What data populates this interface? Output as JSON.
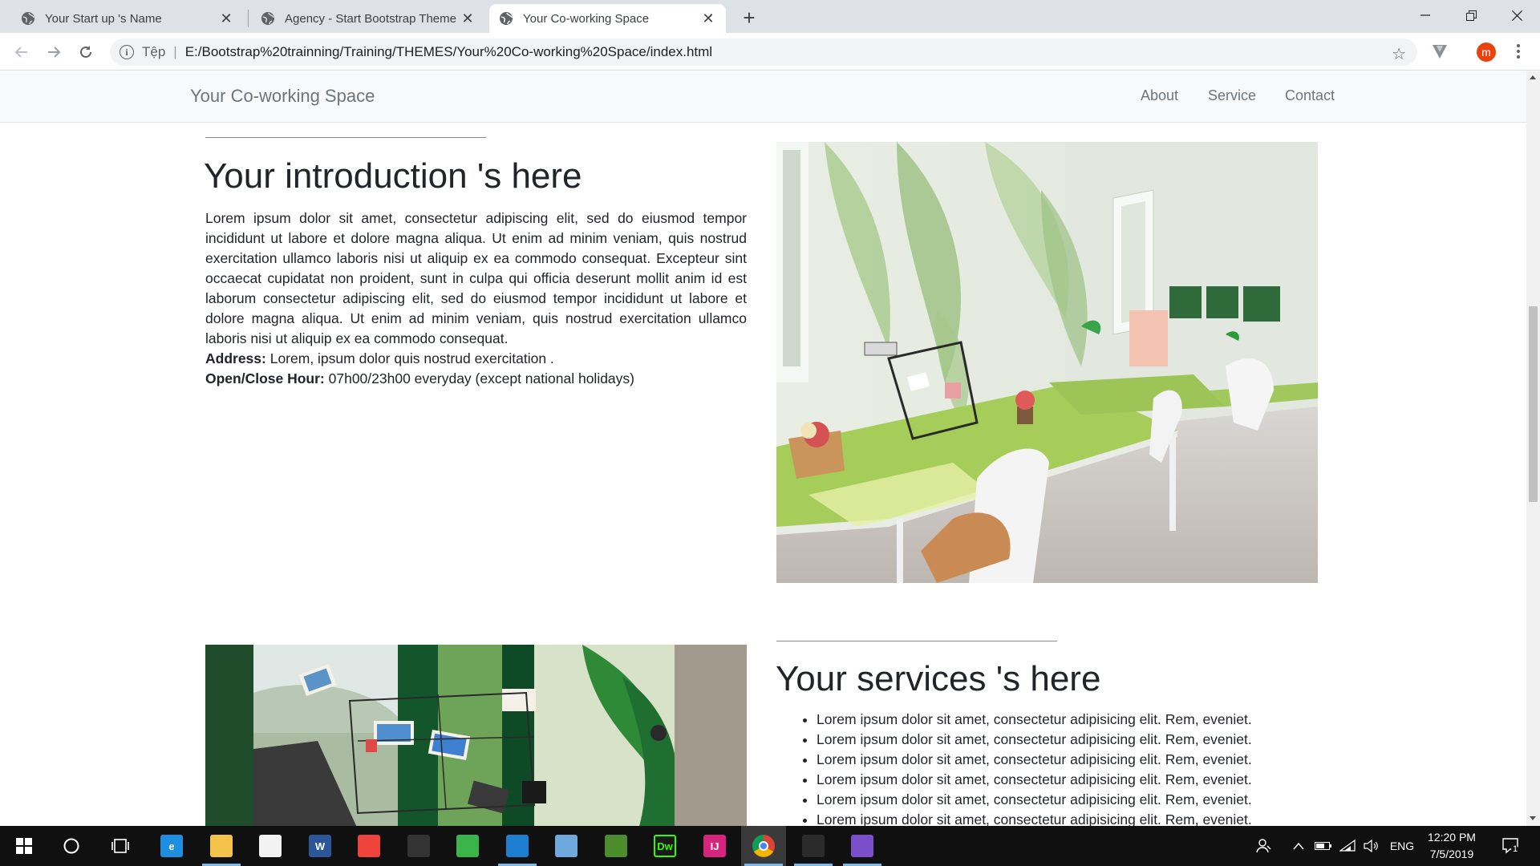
{
  "browser": {
    "tabs": [
      {
        "title": "Your Start up 's Name",
        "active": false
      },
      {
        "title": "Agency - Start Bootstrap Theme",
        "active": false
      },
      {
        "title": "Your Co-working Space",
        "active": true
      }
    ],
    "address": {
      "scheme_label": "Tệp",
      "url": "E:/Bootstrap%20trainning/Training/THEMES/Your%20Co-working%20Space/index.html"
    },
    "profile_initial": "m",
    "profile_color": "#e8430f"
  },
  "site": {
    "brand": "Your Co-working Space",
    "nav": [
      "About",
      "Service",
      "Contact"
    ],
    "intro": {
      "heading": "Your introduction 's here",
      "body": "Lorem ipsum dolor sit amet, consectetur adipiscing elit, sed do eiusmod tempor incididunt ut labore et dolore magna aliqua. Ut enim ad minim veniam, quis nostrud exercitation ullamco laboris nisi ut aliquip ex ea commodo consequat. Excepteur sint occaecat cupidatat non proident, sunt in culpa qui officia deserunt mollit anim id est laborum consectetur adipiscing elit, sed do eiusmod tempor incididunt ut labore et dolore magna aliqua. Ut enim ad minim veniam, quis nostrud exercitation ullamco laboris nisi ut aliquip ex ea commodo consequat.",
      "address_label": "Address:",
      "address_value": " Lorem, ipsum dolor quis nostrud exercitation .",
      "hours_label": "Open/Close Hour:",
      "hours_value": " 07h00/23h00 everyday (except national holidays)"
    },
    "services": {
      "heading": "Your services 's here",
      "items": [
        "Lorem ipsum dolor sit amet, consectetur adipisicing elit. Rem, eveniet.",
        "Lorem ipsum dolor sit amet, consectetur adipisicing elit. Rem, eveniet.",
        "Lorem ipsum dolor sit amet, consectetur adipisicing elit. Rem, eveniet.",
        "Lorem ipsum dolor sit amet, consectetur adipisicing elit. Rem, eveniet.",
        "Lorem ipsum dolor sit amet, consectetur adipisicing elit. Rem, eveniet.",
        "Lorem ipsum dolor sit amet, consectetur adipisicing elit. Rem, eveniet."
      ]
    }
  },
  "taskbar": {
    "language": "ENG",
    "time": "12:20 PM",
    "date": "7/5/2019",
    "notification_count": "1",
    "apps": [
      {
        "name": "edge-icon",
        "label": "e",
        "color": "#1e8fe0",
        "running": false
      },
      {
        "name": "file-explorer-icon",
        "label": "",
        "color": "#f3c34a",
        "running": true
      },
      {
        "name": "store-icon",
        "label": "",
        "color": "#f2f2f2",
        "running": false
      },
      {
        "name": "word-icon",
        "label": "W",
        "color": "#2b579a",
        "running": false
      },
      {
        "name": "anydesk-icon",
        "label": "",
        "color": "#ef443b",
        "running": false
      },
      {
        "name": "tools-icon",
        "label": "",
        "color": "#333333",
        "running": false
      },
      {
        "name": "coccoc-icon",
        "label": "",
        "color": "#3bb44a",
        "running": false
      },
      {
        "name": "vscode-icon",
        "label": "",
        "color": "#1e7fd1",
        "running": true
      },
      {
        "name": "virtualbox-icon",
        "label": "",
        "color": "#6fa8dc",
        "running": false
      },
      {
        "name": "image-viewer-icon",
        "label": "",
        "color": "#4c8c2b",
        "running": false
      },
      {
        "name": "dreamweaver-icon",
        "label": "Dw",
        "color": "#1a1a1a",
        "running": false
      },
      {
        "name": "intellij-icon",
        "label": "IJ",
        "color": "#d6247f",
        "running": false
      },
      {
        "name": "chrome-icon",
        "label": "",
        "color": "#ffffff",
        "running": true
      },
      {
        "name": "terminal-icon",
        "label": "",
        "color": "#2b2b2b",
        "running": true
      },
      {
        "name": "maps-icon",
        "label": "",
        "color": "#7b4fc9",
        "running": true
      }
    ]
  }
}
